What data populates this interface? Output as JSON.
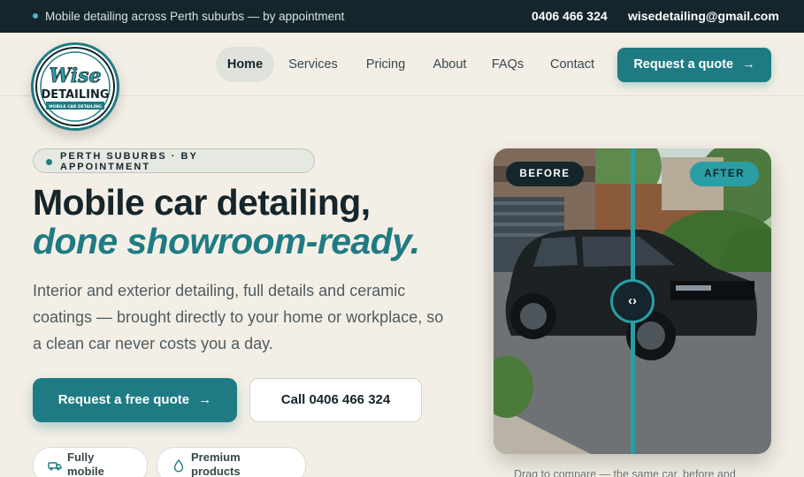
{
  "topbar": {
    "tagline": "Mobile detailing across Perth suburbs — by appointment",
    "phone": "0406 466 324",
    "email": "wisedetailing@gmail.com"
  },
  "logo": {
    "line1": "Wise",
    "line2": "DETAILING",
    "ribbon": "MOBILE CAR DETAILING"
  },
  "nav": {
    "items": [
      {
        "label": "Home",
        "active": true
      },
      {
        "label": "Services"
      },
      {
        "label": "Pricing"
      },
      {
        "label": "About"
      },
      {
        "label": "FAQs"
      },
      {
        "label": "Contact"
      }
    ],
    "cta_label": "Request a quote",
    "cta_arrow": "→"
  },
  "hero": {
    "badge": "PERTH SUBURBS · BY APPOINTMENT",
    "title_line1": "Mobile car detailing,",
    "title_line2": "done showroom-ready.",
    "lead": "Interior and exterior detailing, full details and ceramic coatings — brought directly to your home or workplace, so a clean car never costs you a day.",
    "primary_label": "Request a free quote",
    "primary_arrow": "→",
    "secondary_label": "Call 0406 466 324",
    "chips": [
      {
        "label": "Fully mobile",
        "icon": "van-icon"
      },
      {
        "label": "Premium products",
        "icon": "droplet-icon"
      }
    ]
  },
  "compare": {
    "before_label": "BEFORE",
    "after_label": "AFTER",
    "handle_glyph": "‹›",
    "caption": "Drag to compare — the same car, before and"
  },
  "colors": {
    "teal": "#1f7b83",
    "dark": "#14252b",
    "cream": "#f4efe6"
  }
}
